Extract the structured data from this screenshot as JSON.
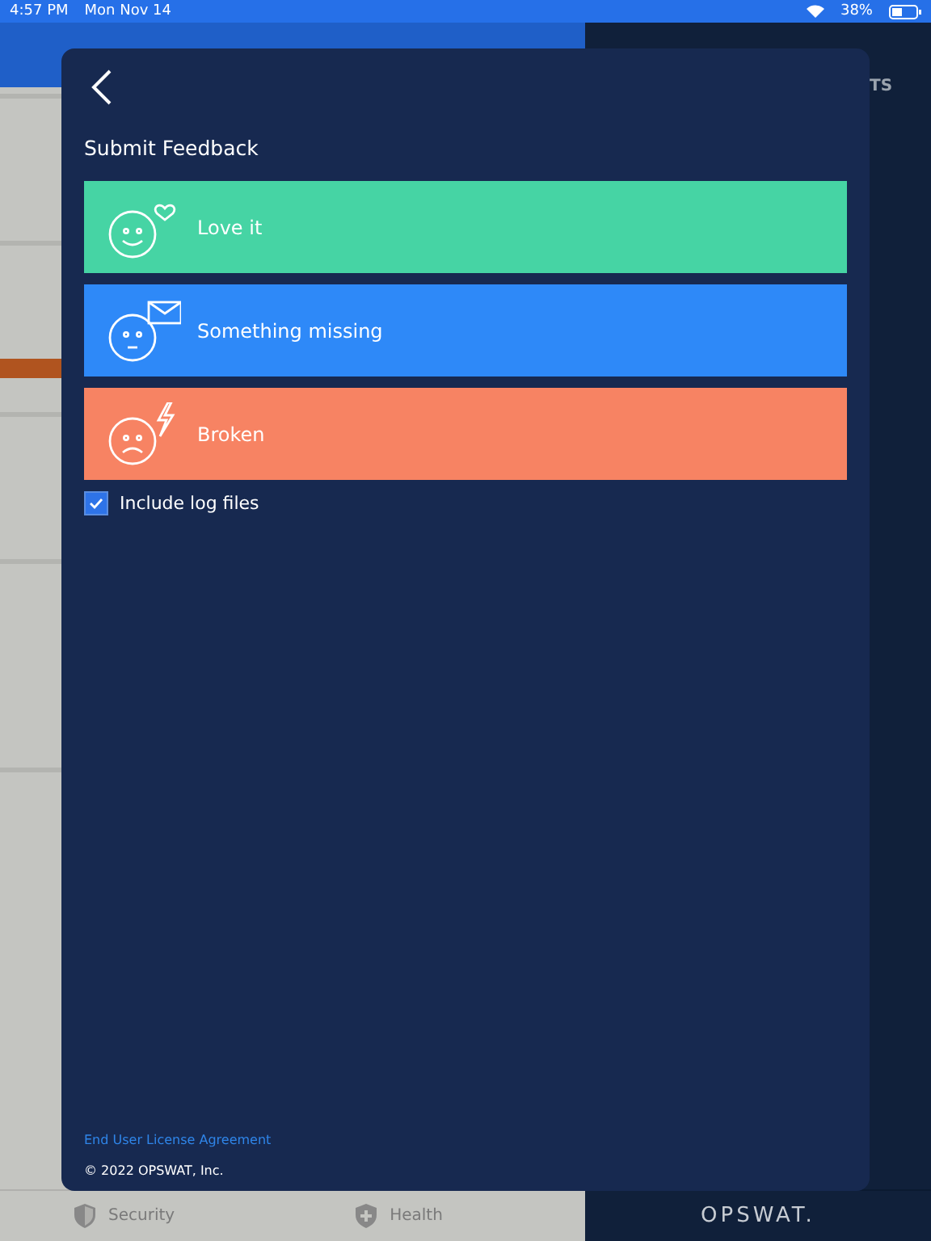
{
  "status_bar": {
    "time": "4:57 PM",
    "date": "Mon Nov 14",
    "battery": "38%"
  },
  "background": {
    "side_heading": "TS",
    "tabs": [
      {
        "label": "Security",
        "kind": "security"
      },
      {
        "label": "Health",
        "kind": "health"
      }
    ],
    "brand": "OPSWAT."
  },
  "dialog": {
    "title": "Submit Feedback",
    "options": [
      {
        "label": "Love it",
        "kind": "love",
        "color": "#46d4a4"
      },
      {
        "label": "Something missing",
        "kind": "missing",
        "color": "#2e89f8"
      },
      {
        "label": "Broken",
        "kind": "broken",
        "color": "#f78363"
      }
    ],
    "include_logs": {
      "label": "Include log files",
      "checked": true
    },
    "license_link": "End User License Agreement",
    "copyright": "© 2022 OPSWAT, Inc."
  }
}
